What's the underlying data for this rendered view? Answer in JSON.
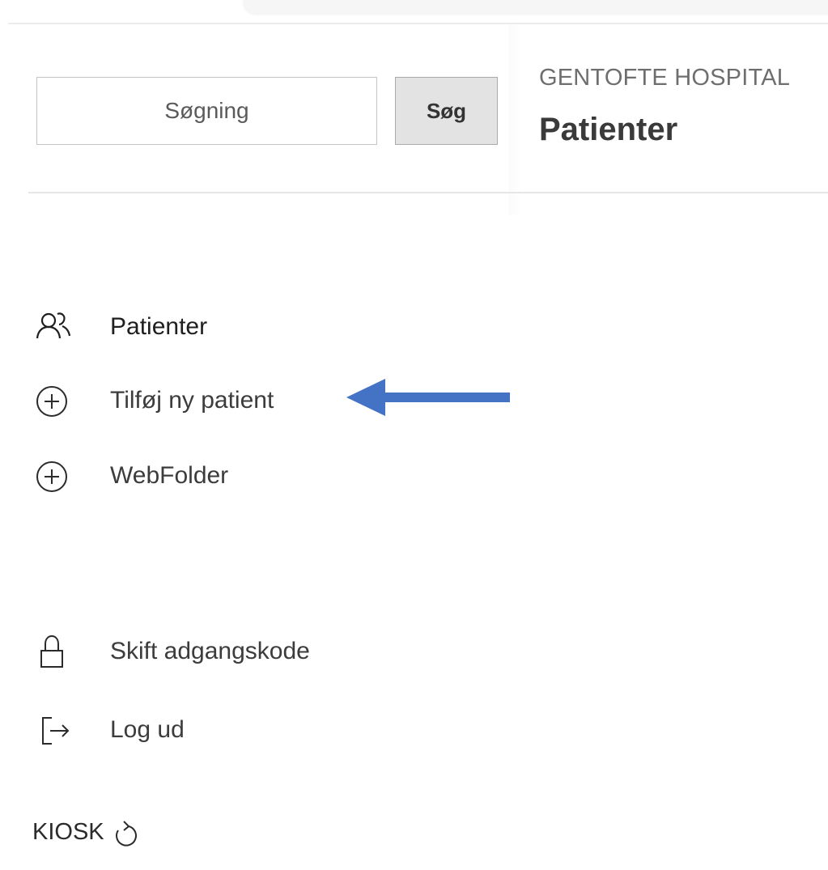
{
  "search": {
    "placeholder": "Søgning",
    "button_label": "Søg"
  },
  "header": {
    "hospital": "GENTOFTE HOSPITAL",
    "title": "Patienter"
  },
  "menu": {
    "items": [
      {
        "label": "Patienter",
        "icon": "users-icon"
      },
      {
        "label": "Tilføj ny patient",
        "icon": "plus-circle-icon"
      },
      {
        "label": "WebFolder",
        "icon": "plus-circle-icon"
      }
    ],
    "account": [
      {
        "label": "Skift adgangskode",
        "icon": "lock-icon"
      },
      {
        "label": "Log ud",
        "icon": "sign-out-icon"
      }
    ]
  },
  "kiosk": {
    "label": "KIOSK",
    "icon": "refresh-icon"
  },
  "annotation": {
    "arrow_color": "#4472C4",
    "points_to": "Tilføj ny patient"
  }
}
